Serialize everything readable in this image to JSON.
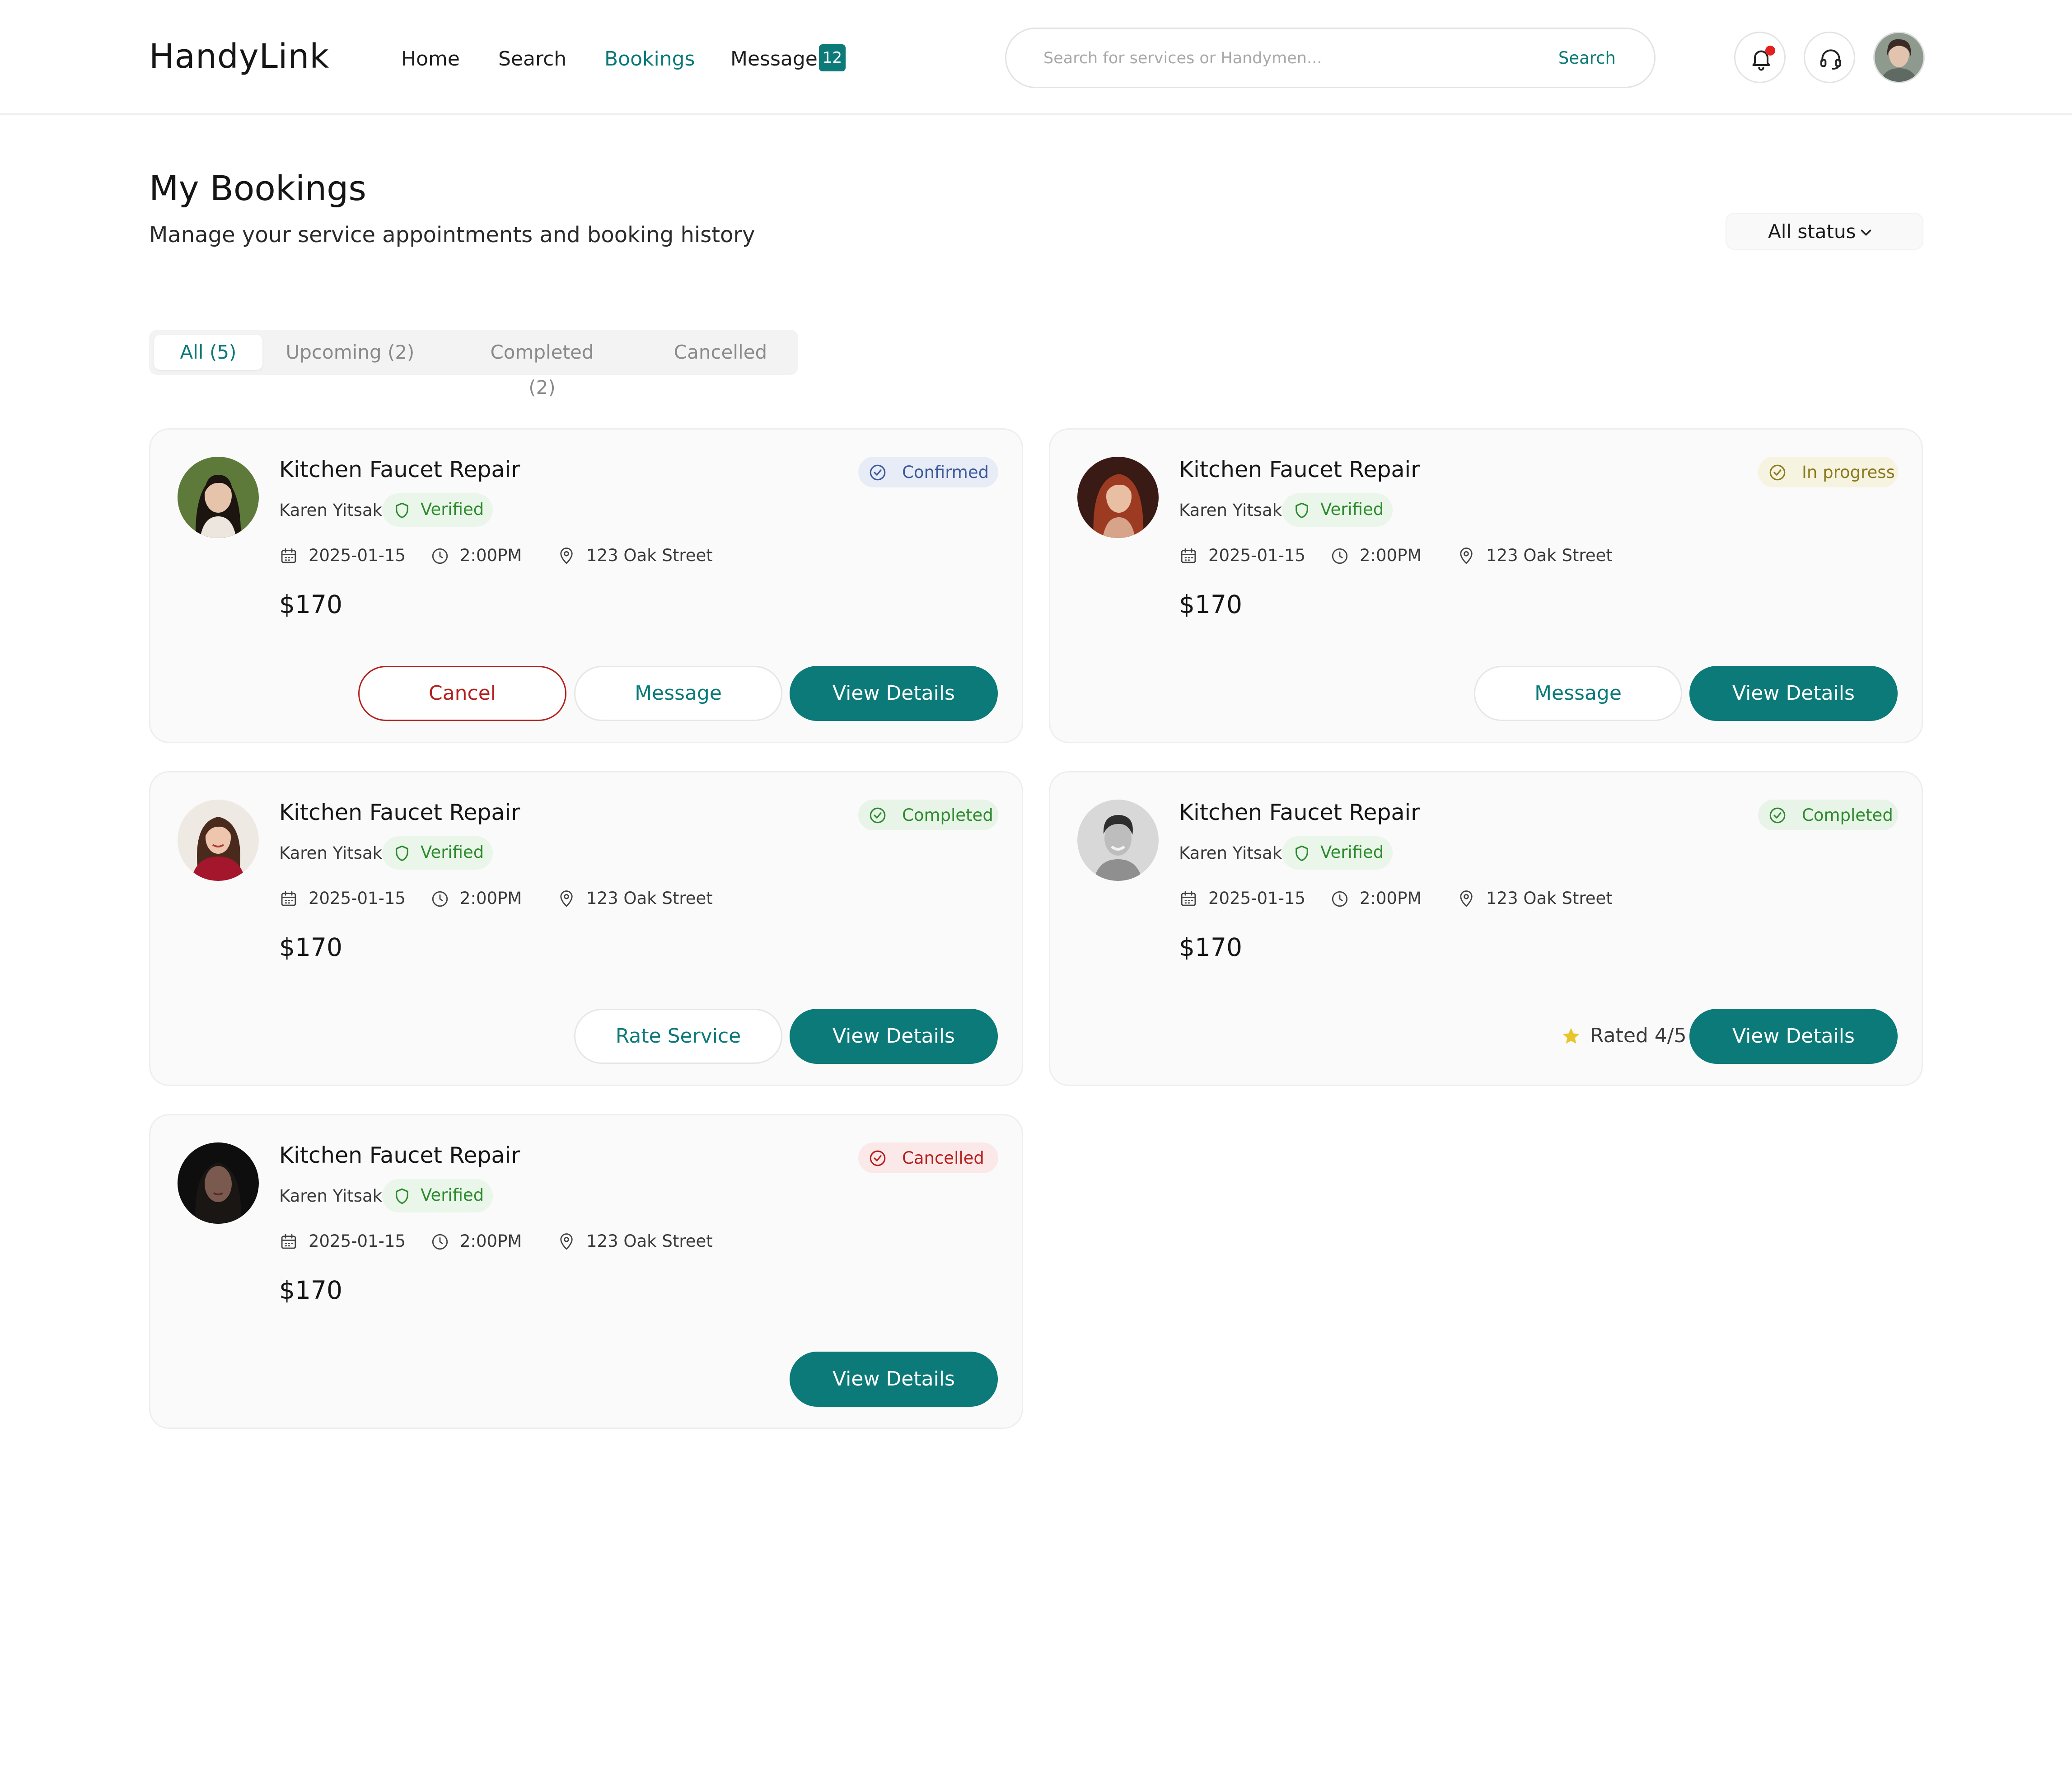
{
  "app": {
    "logo": "HandyLink"
  },
  "nav": {
    "home": "Home",
    "search": "Search",
    "bookings": "Bookings",
    "message": "Message",
    "message_badge": "12"
  },
  "searchbar": {
    "placeholder": "Search for services or Handymen...",
    "button": "Search"
  },
  "header_icons": [
    "bell-icon",
    "headset-icon",
    "avatar"
  ],
  "page": {
    "title": "My Bookings",
    "subtitle": "Manage your service appointments and booking history",
    "status_filter": "All status"
  },
  "tabs": [
    {
      "label": "All (5)",
      "active": true
    },
    {
      "label": "Upcoming (2)",
      "active": false
    },
    {
      "label": "Completed (2)",
      "active": false
    },
    {
      "label": "Cancelled",
      "active": false
    }
  ],
  "colors": {
    "accent": "#0b7a78",
    "confirmed": "#3d5a99",
    "in_progress": "#8b7a1e",
    "completed": "#2e8a2e",
    "cancelled": "#b3201e",
    "star": "#e8c52a"
  },
  "bookings": [
    {
      "title": "Kitchen Faucet Repair",
      "provider": "Karen Yitsak",
      "verified": "Verified",
      "status": "Confirmed",
      "date": "2025-01-15",
      "time": "2:00PM",
      "address": "123 Oak Street",
      "price": "$170",
      "actions": {
        "cancel": "Cancel",
        "message": "Message",
        "details": "View Details"
      }
    },
    {
      "title": "Kitchen Faucet Repair",
      "provider": "Karen Yitsak",
      "verified": "Verified",
      "status": "In progress",
      "date": "2025-01-15",
      "time": "2:00PM",
      "address": "123 Oak Street",
      "price": "$170",
      "actions": {
        "message": "Message",
        "details": "View Details"
      }
    },
    {
      "title": "Kitchen Faucet Repair",
      "provider": "Karen Yitsak",
      "verified": "Verified",
      "status": "Completed",
      "date": "2025-01-15",
      "time": "2:00PM",
      "address": "123 Oak Street",
      "price": "$170",
      "actions": {
        "rate": "Rate Service",
        "details": "View Details"
      }
    },
    {
      "title": "Kitchen Faucet Repair",
      "provider": "Karen Yitsak",
      "verified": "Verified",
      "status": "Completed",
      "date": "2025-01-15",
      "time": "2:00PM",
      "address": "123 Oak Street",
      "price": "$170",
      "rating_text": "Rated 4/5",
      "actions": {
        "details": "View Details"
      }
    },
    {
      "title": "Kitchen Faucet Repair",
      "provider": "Karen Yitsak",
      "verified": "Verified",
      "status": "Cancelled",
      "date": "2025-01-15",
      "time": "2:00PM",
      "address": "123 Oak Street",
      "price": "$170",
      "actions": {
        "details": "View Details"
      }
    }
  ]
}
